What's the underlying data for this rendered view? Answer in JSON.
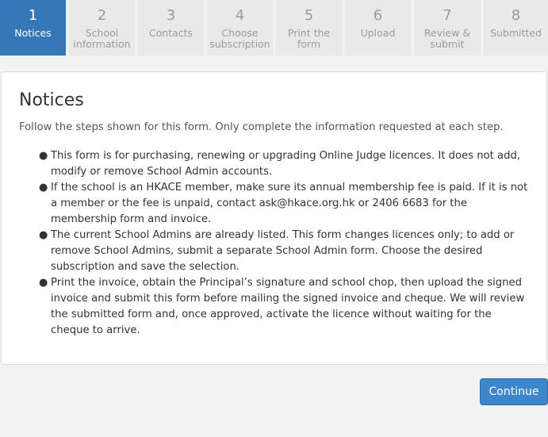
{
  "steps": [
    {
      "number": "1",
      "label": "Notices",
      "active": true
    },
    {
      "number": "2",
      "label": "School information",
      "active": false
    },
    {
      "number": "3",
      "label": "Contacts",
      "active": false
    },
    {
      "number": "4",
      "label": "Choose subscription",
      "active": false
    },
    {
      "number": "5",
      "label": "Print the form",
      "active": false
    },
    {
      "number": "6",
      "label": "Upload",
      "active": false
    },
    {
      "number": "7",
      "label": "Review & submit",
      "active": false
    },
    {
      "number": "8",
      "label": "Submitted",
      "active": false
    }
  ],
  "notices": {
    "title": "Notices",
    "intro": "Follow the steps shown for this form. Only complete the information requested at each step.",
    "items": [
      "This form is for purchasing, renewing or upgrading Online Judge licences. It does not add, modify or remove School Admin accounts.",
      "If the school is an HKACE member, make sure its annual membership fee is paid. If it is not a member or the fee is unpaid, contact ask@hkace.org.hk or 2406 6683 for the membership form and invoice.",
      "The current School Admins are already listed. This form changes licences only; to add or remove School Admins, submit a separate School Admin form. Choose the desired subscription and save the selection.",
      "Print the invoice, obtain the Principal’s signature and school chop, then upload the signed invoice and submit this form before mailing the signed invoice and cheque. We will review the submitted form and, once approved, activate the licence without waiting for the cheque to arrive."
    ]
  },
  "actions": {
    "continue_label": "Continue"
  },
  "colors": {
    "active_step": "#3478b7",
    "inactive_step": "#e9e9e9",
    "button": "#3d86cb"
  }
}
